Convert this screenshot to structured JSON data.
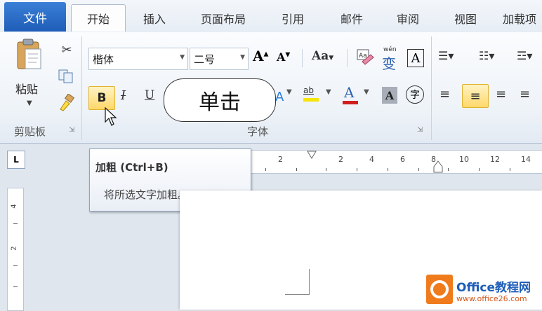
{
  "tabs": {
    "file": "文件",
    "items": [
      "开始",
      "插入",
      "页面布局",
      "引用",
      "邮件",
      "审阅",
      "视图",
      "加载项"
    ],
    "active_index": 0
  },
  "clipboard": {
    "paste_label": "粘贴",
    "group_label": "剪贴板"
  },
  "font": {
    "font_name": "楷体",
    "font_size": "二号",
    "group_label": "字体",
    "grow_label": "A",
    "shrink_label": "A",
    "case_label": "Aa",
    "bold_label": "B",
    "italic_label": "I",
    "underline_label": "U",
    "highlight_label": "ab",
    "color_label": "A",
    "shade_label": "A",
    "enclose_label": "字",
    "phonetic_label": "wén",
    "phonetic_char": "变",
    "border_label": "A"
  },
  "callout": {
    "text": "单击"
  },
  "tooltip": {
    "title": "加粗 (Ctrl+B)",
    "description": "将所选文字加粗。"
  },
  "ruler": {
    "tab_selector": "L",
    "labels": [
      "2",
      "2",
      "4",
      "6",
      "8",
      "10",
      "12",
      "14"
    ]
  },
  "vertical_ruler": {
    "labels": [
      "4",
      "2"
    ]
  },
  "watermark": {
    "brand": "Office教程网",
    "url": "www.office26.com"
  },
  "colors": {
    "file_tab": "#1f5db8",
    "highlight": "#ffd86a",
    "font_color": "#d01f1f",
    "logo": "#f07b1c"
  }
}
